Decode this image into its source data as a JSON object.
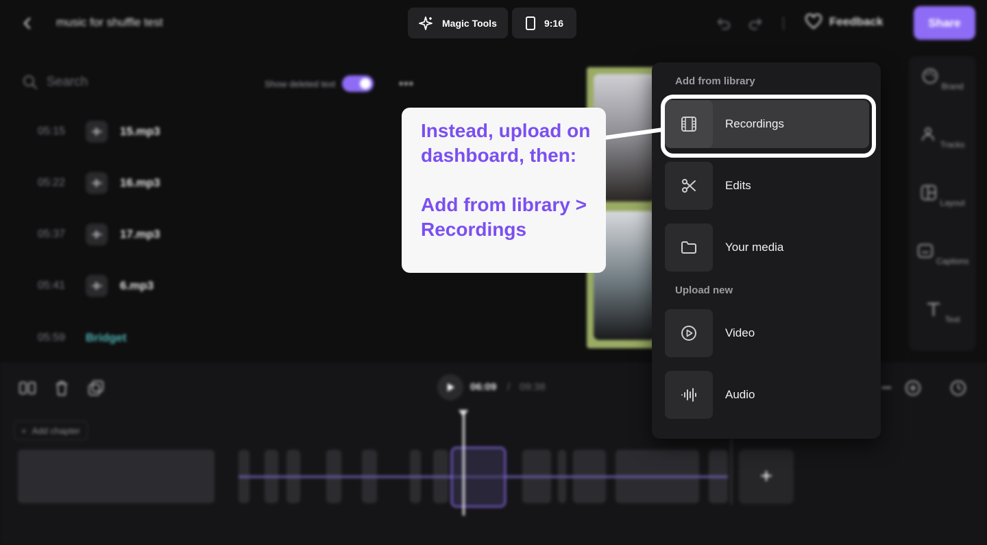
{
  "topbar": {
    "project_title": "music for shuffle test",
    "magic_tools_label": "Magic Tools",
    "aspect_ratio_label": "9:16",
    "feedback_label": "Feedback",
    "share_label": "Share"
  },
  "transcript": {
    "search_placeholder": "Search",
    "show_deleted_label": "Show deleted text",
    "show_deleted_on": true,
    "clips": [
      {
        "time": "05:15",
        "name": "15.mp3"
      },
      {
        "time": "05:22",
        "name": "16.mp3"
      },
      {
        "time": "05:37",
        "name": "17.mp3"
      },
      {
        "time": "05:41",
        "name": "6.mp3"
      },
      {
        "time": "05:59",
        "name": "Bridget"
      }
    ]
  },
  "right_rail": {
    "items": [
      "Brand",
      "Tracks",
      "Layout",
      "Captions",
      "Text"
    ]
  },
  "playback": {
    "current_time": "06:09",
    "separator": "/",
    "total_time": "09:38"
  },
  "timeline": {
    "add_chapter_label": "Add chapter",
    "add_clip_symbol": "+"
  },
  "menu": {
    "library_heading": "Add from library",
    "library_items": [
      "Recordings",
      "Edits",
      "Your media"
    ],
    "upload_heading": "Upload new",
    "upload_items": [
      "Video",
      "Audio"
    ],
    "highlighted_item": "Recordings"
  },
  "callout": {
    "line1": "Instead, upload on dashboard, then:",
    "line2": "Add from library > Recordings",
    "text_color": "#7b4ff0"
  },
  "colors": {
    "accent": "#8f6cf6",
    "background": "#0f0f10",
    "speaker_name": "#4fb3b3"
  }
}
